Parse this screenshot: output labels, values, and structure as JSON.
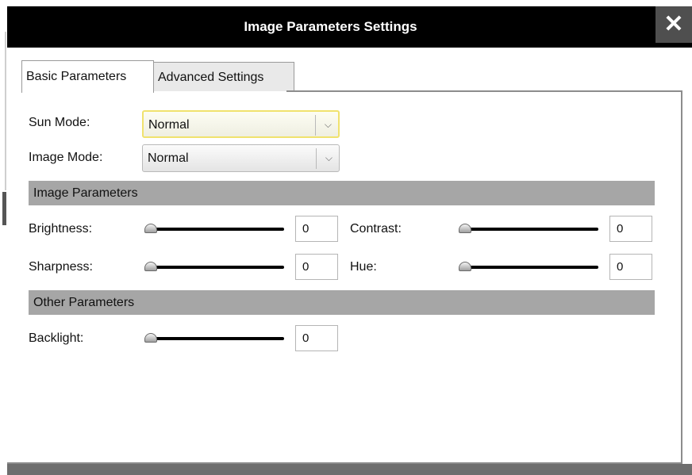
{
  "dialog": {
    "title": "Image Parameters Settings",
    "close_glyph": "✕"
  },
  "tabs": [
    {
      "label": "Basic Parameters",
      "active": true
    },
    {
      "label": "Advanced Settings",
      "active": false
    }
  ],
  "fields": {
    "sun_mode": {
      "label": "Sun Mode:",
      "value": "Normal"
    },
    "image_mode": {
      "label": "Image Mode:",
      "value": "Normal"
    }
  },
  "sections": {
    "image_parameters": "Image Parameters",
    "other_parameters": "Other Parameters"
  },
  "sliders": {
    "brightness": {
      "label": "Brightness:",
      "value": "0"
    },
    "contrast": {
      "label": "Contrast:",
      "value": "0"
    },
    "sharpness": {
      "label": "Sharpness:",
      "value": "0"
    },
    "hue": {
      "label": "Hue:",
      "value": "0"
    },
    "backlight": {
      "label": "Backlight:",
      "value": "0"
    }
  },
  "icons": {
    "dropdown": "chevron-down-icon",
    "close": "close-icon"
  },
  "colors": {
    "titlebar": "#000000",
    "section_header": "#a6a6a6",
    "focus_border": "#f0e26e"
  }
}
